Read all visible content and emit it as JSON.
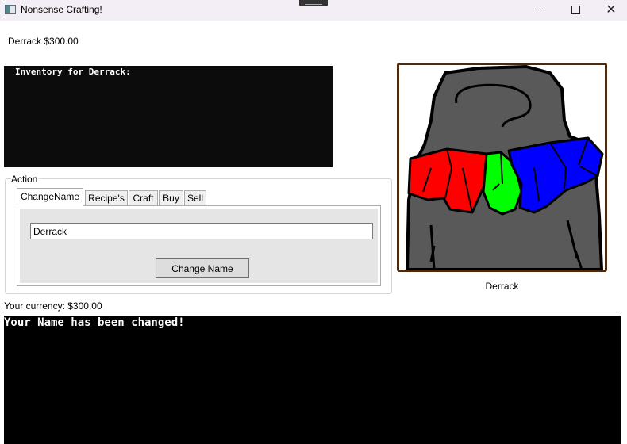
{
  "window": {
    "title": "Nonsense Crafting!",
    "icon": "app-window-icon"
  },
  "header": {
    "player_label": "Derrack $300.00"
  },
  "inventory": {
    "text": "Inventory for Derrack:"
  },
  "portrait": {
    "name": "Derrack",
    "colors": {
      "frame": "#4a2a10",
      "body": "#595959",
      "red": "#ff0000",
      "green": "#00ff00",
      "blue": "#0000ff"
    }
  },
  "action": {
    "label": "Action",
    "tabs": [
      {
        "label": "ChangeName",
        "active": true
      },
      {
        "label": "Recipe's",
        "active": false
      },
      {
        "label": "Craft",
        "active": false
      },
      {
        "label": "Buy",
        "active": false
      },
      {
        "label": "Sell",
        "active": false
      }
    ],
    "name_input_value": "Derrack",
    "change_button_label": "Change Name"
  },
  "currency": {
    "label": "Your currency: $300.00"
  },
  "console": {
    "message": "Your Name has been changed!"
  }
}
